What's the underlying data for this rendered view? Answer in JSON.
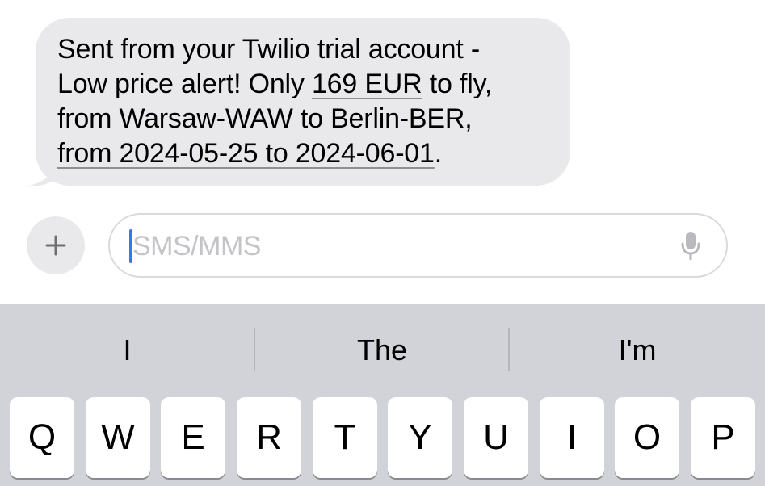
{
  "message": {
    "lines": [
      "Sent from your Twilio trial account -",
      "Low price alert! Only ",
      "169 EUR",
      " to fly,",
      "from Warsaw-WAW to Berlin-BER,",
      "from 2024-05-25 to 2024-06-01",
      "."
    ]
  },
  "composer": {
    "placeholder": "SMS/MMS",
    "plus_icon": "plus-icon",
    "mic_icon": "microphone-icon"
  },
  "keyboard": {
    "suggestions": [
      "I",
      "The",
      "I'm"
    ],
    "keys": [
      "Q",
      "W",
      "E",
      "R",
      "T",
      "Y",
      "U",
      "I",
      "O",
      "P"
    ]
  },
  "colors": {
    "bubble": "#e9e9eb",
    "keyboard_bg": "#d1d3d9",
    "caret": "#3478f6",
    "placeholder": "#c4c4c8"
  }
}
